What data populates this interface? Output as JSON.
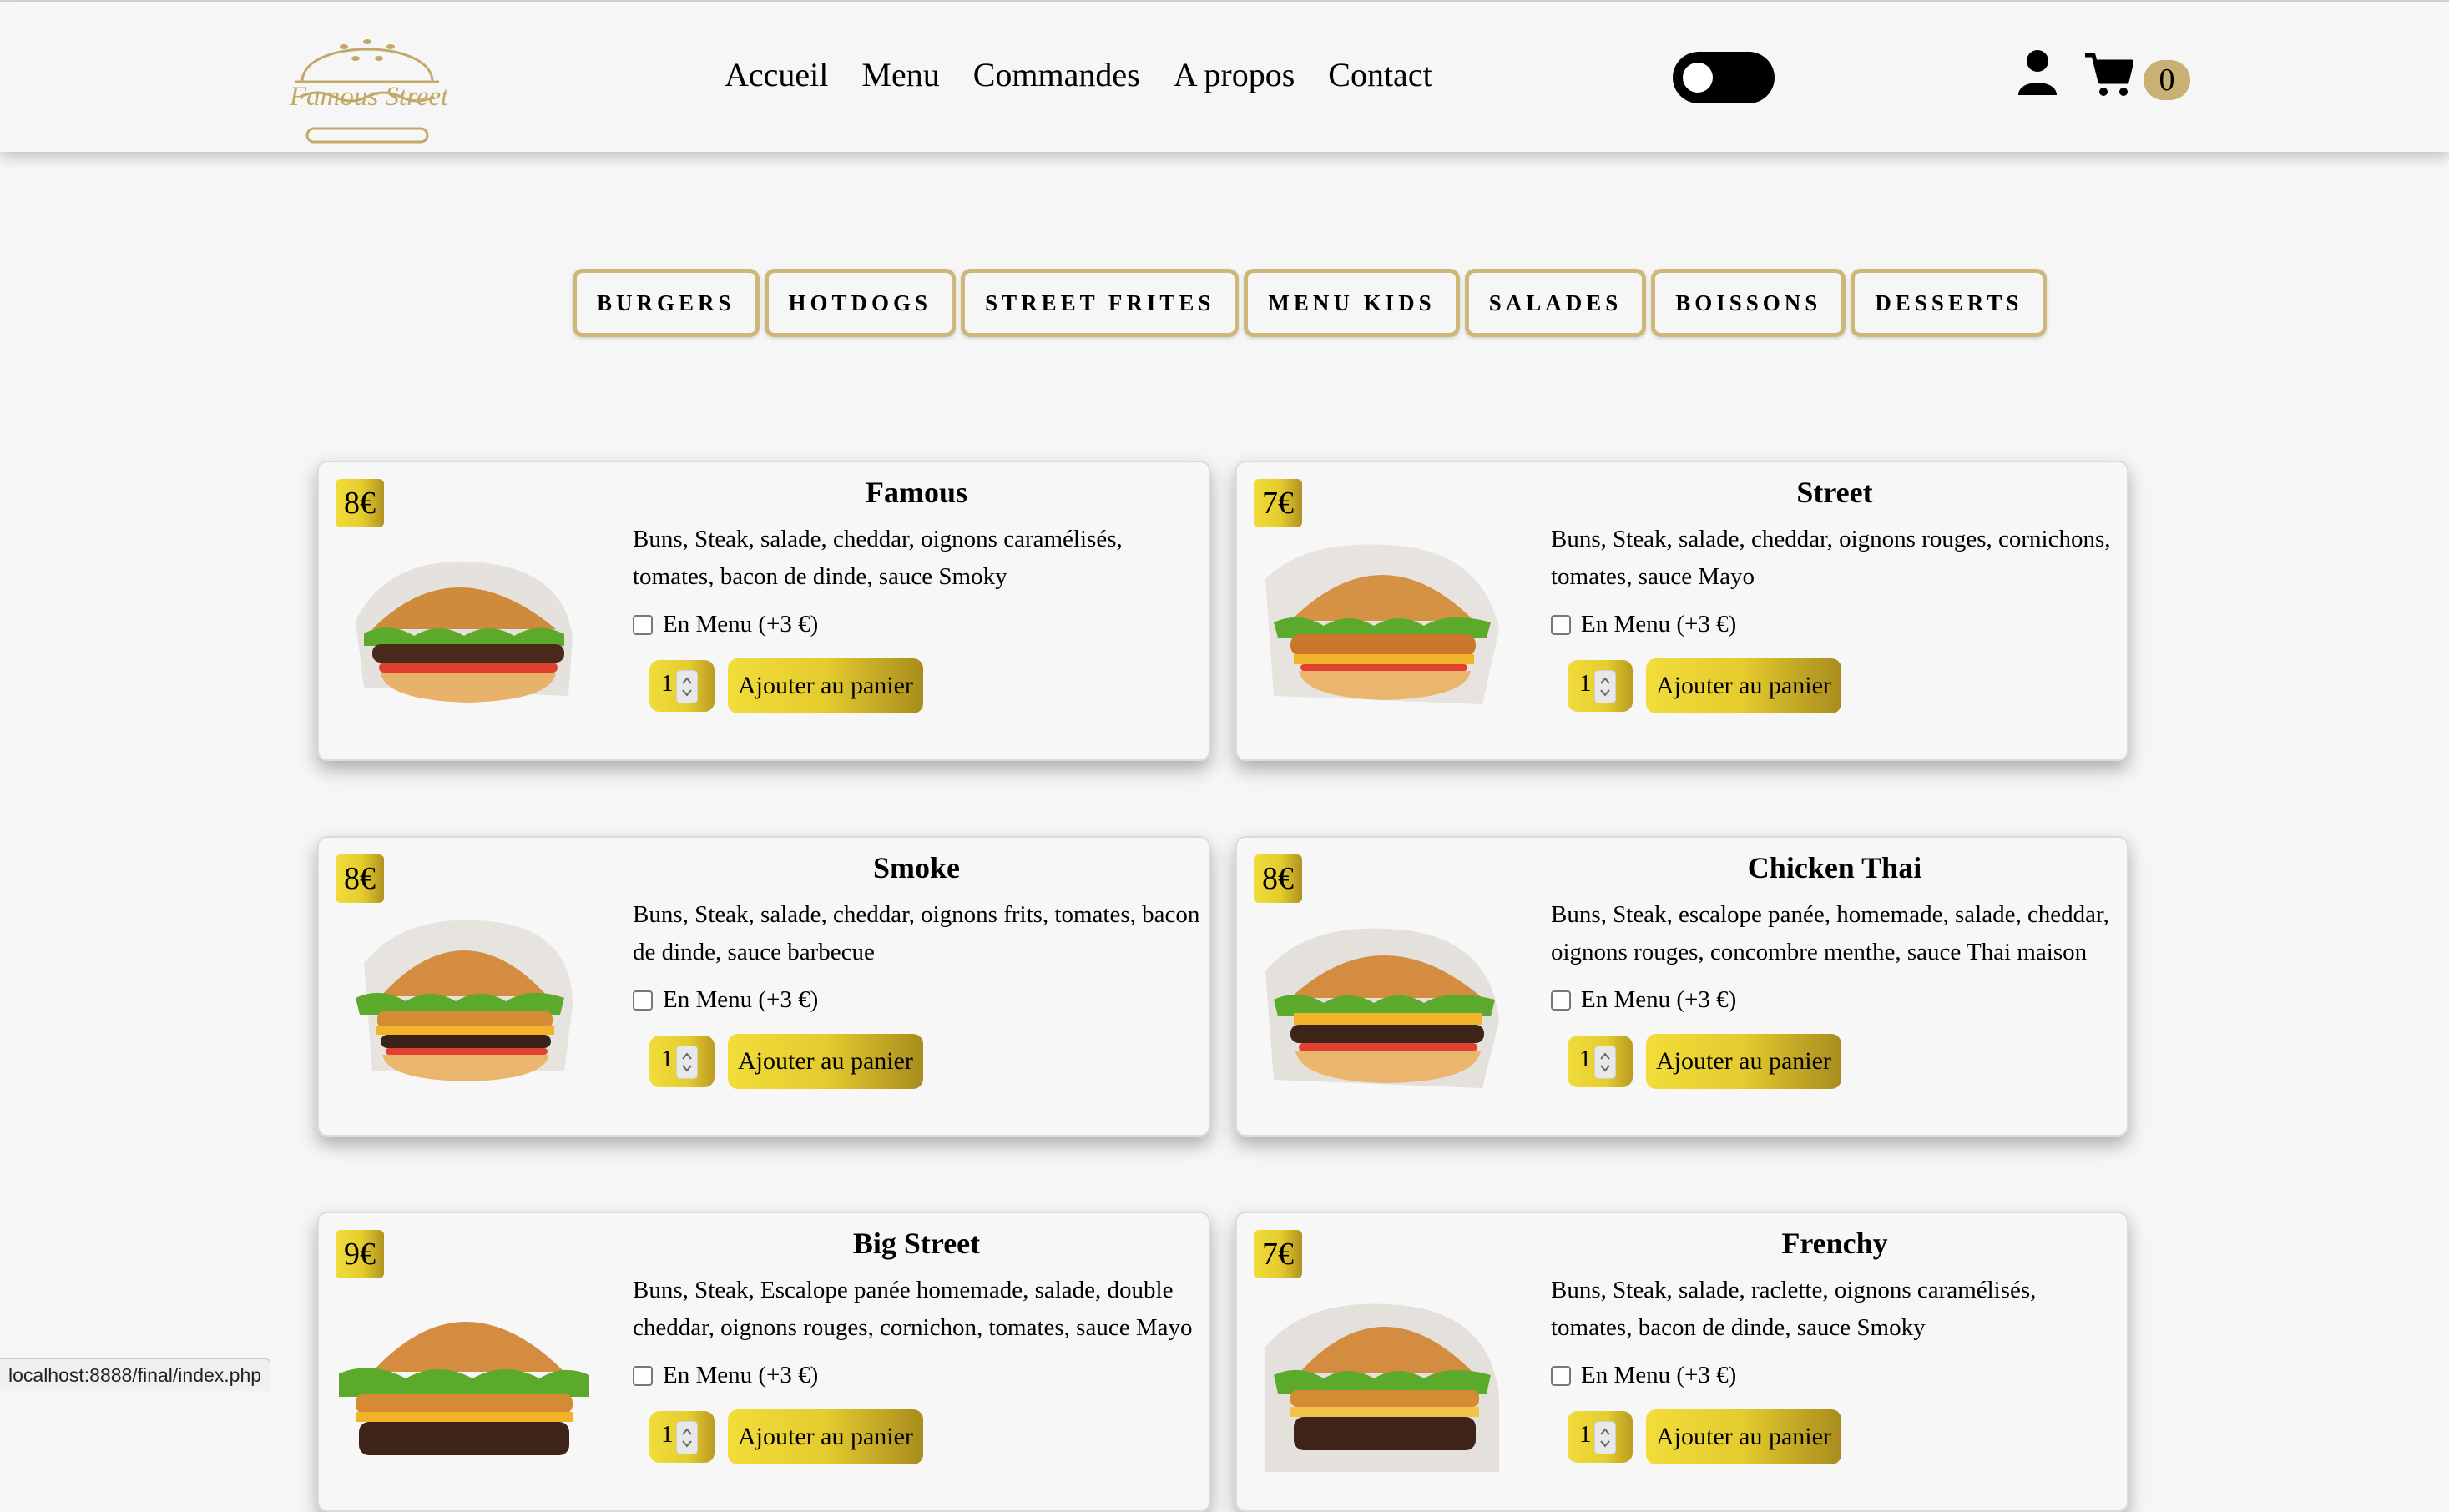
{
  "header": {
    "logo_text": "Famous Street",
    "nav": [
      "Accueil",
      "Menu",
      "Commandes",
      "A propos",
      "Contact"
    ],
    "cart_count": "0",
    "theme_toggle_on": true
  },
  "categories": [
    "BURGERS",
    "HOTDOGS",
    "STREET FRITES",
    "MENU KIDS",
    "SALADES",
    "BOISSONS",
    "DESSERTS"
  ],
  "products": [
    {
      "price": "8€",
      "name": "Famous",
      "description": "Buns, Steak, salade, cheddar, oignons caramélisés, tomates, bacon de dinde, sauce Smoky",
      "menu_option": "En Menu (+3 €)",
      "quantity": "1",
      "add_label": "Ajouter au panier"
    },
    {
      "price": "7€",
      "name": "Street",
      "description": "Buns, Steak, salade, cheddar, oignons rouges, cornichons, tomates, sauce Mayo",
      "menu_option": "En Menu (+3 €)",
      "quantity": "1",
      "add_label": "Ajouter au panier"
    },
    {
      "price": "8€",
      "name": "Smoke",
      "description": "Buns, Steak, salade, cheddar, oignons frits, tomates, bacon de dinde, sauce barbecue",
      "menu_option": "En Menu (+3 €)",
      "quantity": "1",
      "add_label": "Ajouter au panier"
    },
    {
      "price": "8€",
      "name": "Chicken Thai",
      "description": "Buns, Steak, escalope panée, homemade, salade, cheddar, oignons rouges, concombre menthe, sauce Thai maison",
      "menu_option": "En Menu (+3 €)",
      "quantity": "1",
      "add_label": "Ajouter au panier"
    },
    {
      "price": "9€",
      "name": "Big Street",
      "description": "Buns, Steak, Escalope panée homemade, salade, double cheddar, oignons rouges, cornichon, tomates, sauce Mayo",
      "menu_option": "En Menu (+3 €)",
      "quantity": "1",
      "add_label": "Ajouter au panier"
    },
    {
      "price": "7€",
      "name": "Frenchy",
      "description": "Buns, Steak, salade, raclette, oignons caramélisés, tomates, bacon de dinde, sauce Smoky",
      "menu_option": "En Menu (+3 €)",
      "quantity": "1",
      "add_label": "Ajouter au panier"
    }
  ],
  "status_bar": "localhost:8888/final/index.php",
  "colors": {
    "gold": "#c7b173",
    "button_gold": "#e4cc2e",
    "background": "#f6f6f6"
  }
}
